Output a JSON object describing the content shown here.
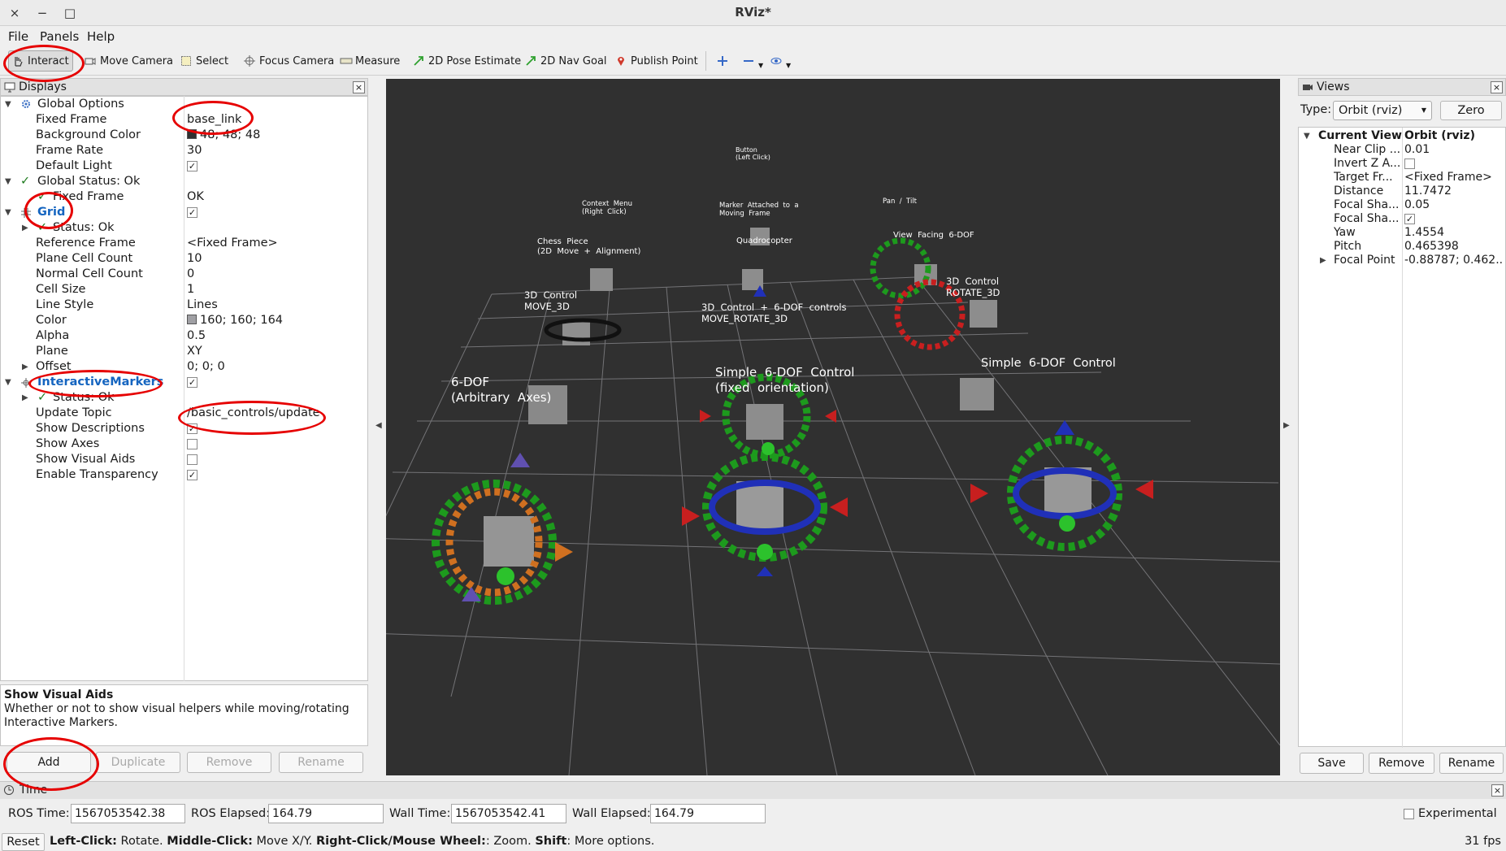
{
  "window": {
    "title": "RViz*",
    "close": "×",
    "minimize": "−",
    "maximize": "□"
  },
  "menu": {
    "file": "File",
    "panels": "Panels",
    "help": "Help"
  },
  "toolbar": {
    "interact": "Interact",
    "move_camera": "Move Camera",
    "select": "Select",
    "focus_camera": "Focus Camera",
    "measure": "Measure",
    "pose_estimate": "2D Pose Estimate",
    "nav_goal": "2D Nav Goal",
    "publish_point": "Publish Point"
  },
  "displays": {
    "title": "Displays",
    "global_options": "Global Options",
    "fixed_frame_label": "Fixed Frame",
    "fixed_frame_value": "base_link",
    "background_color_label": "Background Color",
    "background_color_value": "48; 48; 48",
    "frame_rate_label": "Frame Rate",
    "frame_rate_value": "30",
    "default_light_label": "Default Light",
    "global_status": "Global Status: Ok",
    "gs_fixed_frame_label": "Fixed Frame",
    "gs_fixed_frame_value": "OK",
    "grid": "Grid",
    "grid_status": "Status: Ok",
    "reference_frame_label": "Reference Frame",
    "reference_frame_value": "<Fixed Frame>",
    "plane_cell_count_label": "Plane Cell Count",
    "plane_cell_count_value": "10",
    "normal_cell_count_label": "Normal Cell Count",
    "normal_cell_count_value": "0",
    "cell_size_label": "Cell Size",
    "cell_size_value": "1",
    "line_style_label": "Line Style",
    "line_style_value": "Lines",
    "color_label": "Color",
    "color_value": "160; 160; 164",
    "alpha_label": "Alpha",
    "alpha_value": "0.5",
    "plane_label": "Plane",
    "plane_value": "XY",
    "offset_label": "Offset",
    "offset_value": "0; 0; 0",
    "interactive_markers": "InteractiveMarkers",
    "im_status": "Status: Ok",
    "update_topic_label": "Update Topic",
    "update_topic_value": "/basic_controls/update",
    "show_descriptions_label": "Show Descriptions",
    "show_axes_label": "Show Axes",
    "show_visual_aids_label": "Show Visual Aids",
    "enable_transparency_label": "Enable Transparency",
    "desc_title": "Show Visual Aids",
    "desc_text": "Whether or not to show visual helpers while moving/rotating Interactive Markers.",
    "add": "Add",
    "duplicate": "Duplicate",
    "remove": "Remove",
    "rename": "Rename"
  },
  "colors": {
    "background": "#303030",
    "grid": "#a0a0a4",
    "annotation": "#e60000",
    "ok": "#1e7b1e",
    "link": "#1565c0"
  },
  "viewport_labels": {
    "button": "Button\n(Left Click)",
    "context_menu": "Context  Menu\n(Right  Click)",
    "marker_attached": "Marker  Attached  to  a\nMoving  Frame",
    "pan_tilt": "Pan  /  Tilt",
    "view_facing": "View  Facing  6-DOF",
    "chess_piece": "Chess  Piece\n(2D  Move  +  Alignment)",
    "quadrocopter": "Quadrocopter",
    "control_3d_move": "3D  Control\nMOVE_3D",
    "control_3d_rotate": "3D  Control\nROTATE_3D",
    "control_6dof": "3D  Control  +  6-DOF  controls\nMOVE_ROTATE_3D",
    "six_dof_arbitrary": "6-DOF\n(Arbitrary  Axes)",
    "simple_fixed": "Simple  6-DOF  Control\n(fixed  orientation)",
    "simple": "Simple  6-DOF  Control"
  },
  "views": {
    "title": "Views",
    "type_label": "Type:",
    "type_value": "Orbit (rviz)",
    "zero": "Zero",
    "current_view_label": "Current View",
    "current_view_value": "Orbit (rviz)",
    "near_clip_label": "Near Clip ...",
    "near_clip_value": "0.01",
    "invert_z_label": "Invert Z A...",
    "target_frame_label": "Target Fr...",
    "target_frame_value": "<Fixed Frame>",
    "distance_label": "Distance",
    "distance_value": "11.7472",
    "focal_shape_size_label": "Focal Sha...",
    "focal_shape_size_value": "0.05",
    "focal_shape_fixed_label": "Focal Sha...",
    "yaw_label": "Yaw",
    "yaw_value": "1.4554",
    "pitch_label": "Pitch",
    "pitch_value": "0.465398",
    "focal_point_label": "Focal Point",
    "focal_point_value": "-0.88787; 0.462...",
    "save": "Save",
    "remove": "Remove",
    "rename": "Rename"
  },
  "time": {
    "title": "Time",
    "ros_time_label": "ROS Time:",
    "ros_time_value": "1567053542.38",
    "ros_elapsed_label": "ROS Elapsed:",
    "ros_elapsed_value": "164.79",
    "wall_time_label": "Wall Time:",
    "wall_time_value": "1567053542.41",
    "wall_elapsed_label": "Wall Elapsed:",
    "wall_elapsed_value": "164.79",
    "experimental": "Experimental"
  },
  "status": {
    "reset": "Reset",
    "left_click": "Left-Click:",
    "left_click_text": " Rotate. ",
    "middle_click": "Middle-Click:",
    "middle_click_text": " Move X/Y. ",
    "right_click": "Right-Click/Mouse Wheel:",
    "right_click_text": ": Zoom. ",
    "shift": "Shift",
    "shift_text": ": More options.",
    "fps": "31 fps"
  }
}
